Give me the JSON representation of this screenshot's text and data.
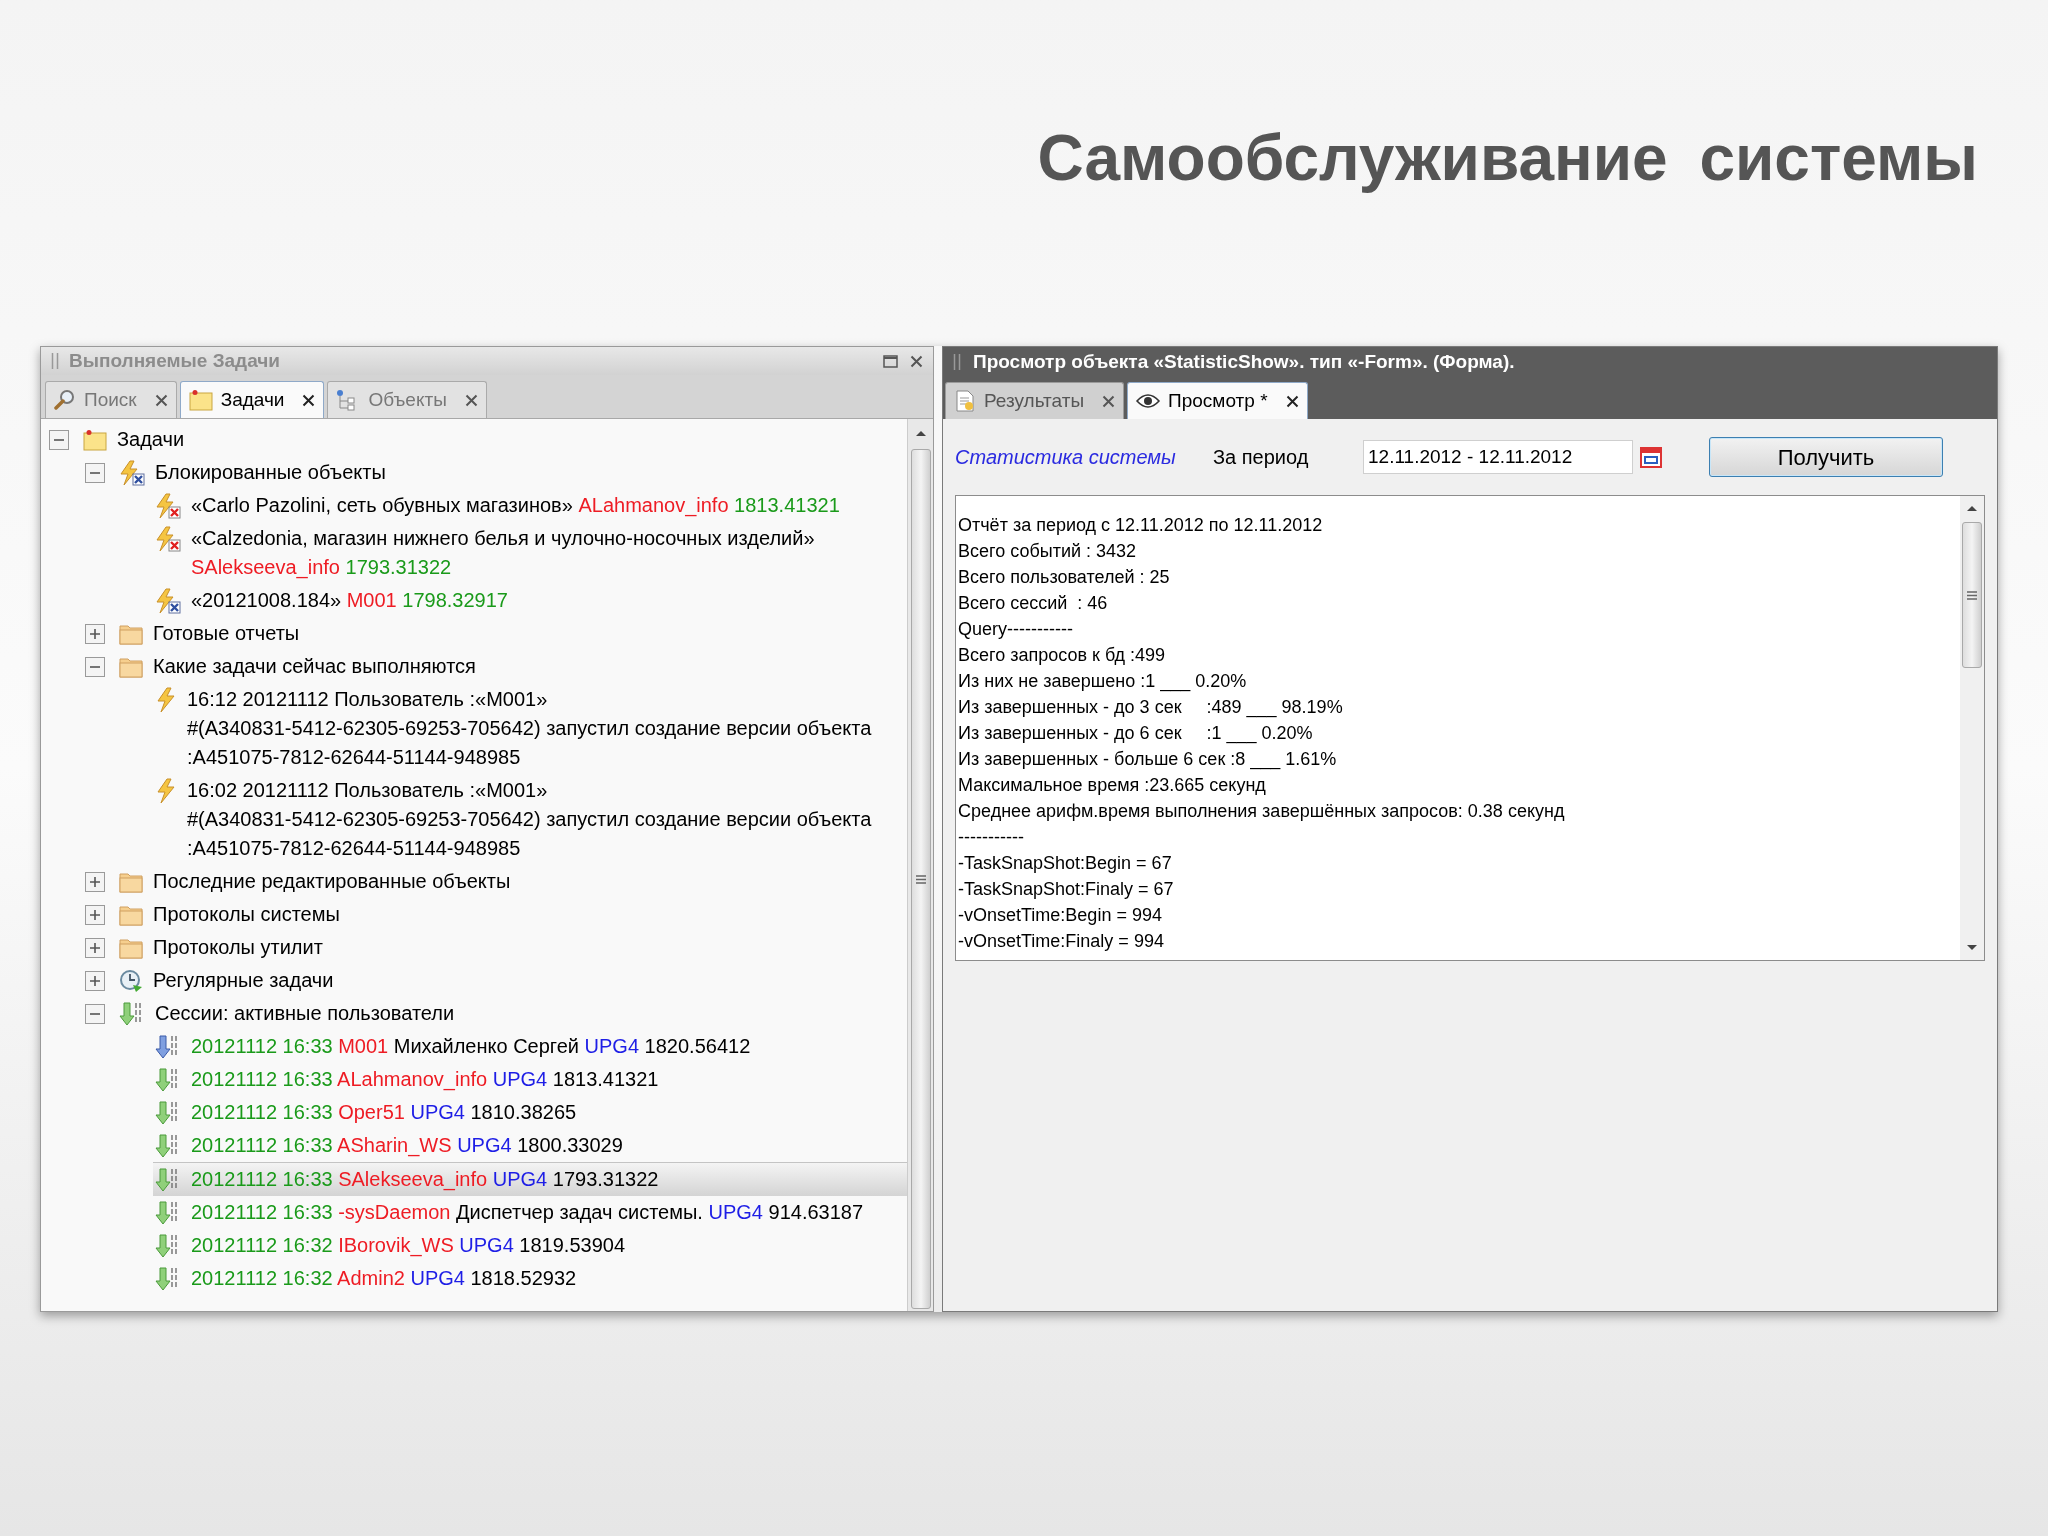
{
  "slide_title": "Самообслуживание системы",
  "left_panel": {
    "title": "Выполняемые Задачи",
    "tabs": [
      {
        "label": "Поиск",
        "kind": "search",
        "selected": false
      },
      {
        "label": "Задачи",
        "kind": "tasks",
        "selected": true
      },
      {
        "label": "Объекты",
        "kind": "hierarchy",
        "selected": false
      }
    ],
    "tree": {
      "kind": "tasks",
      "expanded": true,
      "selected": false,
      "label": [
        {
          "text": "Задачи",
          "color": "#000000"
        }
      ],
      "children": [
        {
          "kind": "locked",
          "expanded": true,
          "selected": false,
          "label": [
            {
              "text": "Блокированные объекты",
              "color": "#000000"
            }
          ],
          "children": [
            {
              "kind": "blocked",
              "selected": false,
              "label": [
                {
                  "text": "«Carlo Pazolini, сеть обувных магазинов»",
                  "color": "#000000"
                },
                {
                  "text": "ALahmanov_info",
                  "color": "#ee1c24"
                },
                {
                  "text": "1813.41321",
                  "color": "#1a9a1a"
                }
              ]
            },
            {
              "kind": "blocked",
              "selected": false,
              "label": [
                {
                  "text": "«Calzedonia, магазин нижнего белья и чулочно-носочных изделий»",
                  "color": "#000000"
                },
                {
                  "text": "SAlekseeva_info",
                  "color": "#ee1c24"
                },
                {
                  "text": "1793.31322",
                  "color": "#1a9a1a"
                }
              ]
            },
            {
              "kind": "locked",
              "selected": false,
              "label": [
                {
                  "text": "«20121008.184»",
                  "color": "#000000"
                },
                {
                  "text": "M001",
                  "color": "#ee1c24"
                },
                {
                  "text": "1798.32917",
                  "color": "#1a9a1a"
                }
              ]
            }
          ]
        },
        {
          "kind": "folder",
          "expanded": false,
          "selected": false,
          "label": [
            {
              "text": "Готовые отчеты",
              "color": "#000000"
            }
          ]
        },
        {
          "kind": "folder",
          "expanded": true,
          "selected": false,
          "label": [
            {
              "text": "Какие задачи сейчас выполняются",
              "color": "#000000"
            }
          ],
          "children": [
            {
              "kind": "bolt",
              "selected": false,
              "lines": [
                "16:12 20121112 Пользователь :«M001»",
                "#(A340831-5412-62305-69253-705642) запустил создание версии объекта",
                ":A451075-7812-62644-51144-948985"
              ]
            },
            {
              "kind": "bolt",
              "selected": false,
              "lines": [
                "16:02 20121112 Пользователь :«M001»",
                "#(A340831-5412-62305-69253-705642) запустил создание версии объекта",
                ":A451075-7812-62644-51144-948985"
              ]
            }
          ]
        },
        {
          "kind": "folder",
          "expanded": false,
          "selected": false,
          "label": [
            {
              "text": "Последние редактированные объекты",
              "color": "#000000"
            }
          ]
        },
        {
          "kind": "folder",
          "expanded": false,
          "selected": false,
          "label": [
            {
              "text": "Протоколы системы",
              "color": "#000000"
            }
          ]
        },
        {
          "kind": "folder",
          "expanded": false,
          "selected": false,
          "label": [
            {
              "text": "Протоколы утилит",
              "color": "#000000"
            }
          ]
        },
        {
          "kind": "schedule",
          "expanded": false,
          "selected": false,
          "label": [
            {
              "text": "Регулярные задачи",
              "color": "#000000"
            }
          ]
        },
        {
          "kind": "session",
          "expanded": true,
          "selected": false,
          "label": [
            {
              "text": "Сессии: активные пользователи",
              "color": "#000000"
            }
          ],
          "children": [
            {
              "kind": "current",
              "selected": false,
              "label": [
                {
                  "text": "20121112 16:33",
                  "color": "#1a9a1a"
                },
                {
                  "text": "M001",
                  "color": "#ee1c24"
                },
                {
                  "text": "Михайленко Сергей",
                  "color": "#000000"
                },
                {
                  "text": "UPG4",
                  "color": "#1e1ee6"
                },
                {
                  "text": "1820.56412",
                  "color": "#000000"
                }
              ]
            },
            {
              "kind": "session",
              "selected": false,
              "label": [
                {
                  "text": "20121112 16:33",
                  "color": "#1a9a1a"
                },
                {
                  "text": "ALahmanov_info",
                  "color": "#ee1c24"
                },
                {
                  "text": "UPG4",
                  "color": "#1e1ee6"
                },
                {
                  "text": "1813.41321",
                  "color": "#000000"
                }
              ]
            },
            {
              "kind": "session",
              "selected": false,
              "label": [
                {
                  "text": "20121112 16:33",
                  "color": "#1a9a1a"
                },
                {
                  "text": "Oper51",
                  "color": "#ee1c24"
                },
                {
                  "text": "UPG4",
                  "color": "#1e1ee6"
                },
                {
                  "text": "1810.38265",
                  "color": "#000000"
                }
              ]
            },
            {
              "kind": "session",
              "selected": false,
              "label": [
                {
                  "text": "20121112 16:33",
                  "color": "#1a9a1a"
                },
                {
                  "text": "ASharin_WS",
                  "color": "#ee1c24"
                },
                {
                  "text": "UPG4",
                  "color": "#1e1ee6"
                },
                {
                  "text": "1800.33029",
                  "color": "#000000"
                }
              ]
            },
            {
              "kind": "session",
              "selected": true,
              "label": [
                {
                  "text": "20121112 16:33",
                  "color": "#1a9a1a"
                },
                {
                  "text": "SAlekseeva_info",
                  "color": "#ee1c24"
                },
                {
                  "text": "UPG4",
                  "color": "#1e1ee6"
                },
                {
                  "text": "1793.31322",
                  "color": "#000000"
                }
              ]
            },
            {
              "kind": "session",
              "selected": false,
              "label": [
                {
                  "text": "20121112 16:33",
                  "color": "#1a9a1a"
                },
                {
                  "text": "-sysDaemon",
                  "color": "#ee1c24"
                },
                {
                  "text": "Диспетчер задач системы.",
                  "color": "#000000"
                },
                {
                  "text": "UPG4",
                  "color": "#1e1ee6"
                },
                {
                  "text": "914.63187",
                  "color": "#000000"
                }
              ]
            },
            {
              "kind": "session",
              "selected": false,
              "label": [
                {
                  "text": "20121112 16:32",
                  "color": "#1a9a1a"
                },
                {
                  "text": "IBorovik_WS",
                  "color": "#ee1c24"
                },
                {
                  "text": "UPG4",
                  "color": "#1e1ee6"
                },
                {
                  "text": "1819.53904",
                  "color": "#000000"
                }
              ]
            },
            {
              "kind": "session",
              "selected": false,
              "label": [
                {
                  "text": "20121112 16:32",
                  "color": "#1a9a1a"
                },
                {
                  "text": "Admin2",
                  "color": "#ee1c24"
                },
                {
                  "text": "UPG4",
                  "color": "#1e1ee6"
                },
                {
                  "text": "1818.52932",
                  "color": "#000000"
                }
              ]
            }
          ]
        }
      ]
    }
  },
  "right_panel": {
    "title": "Просмотр объекта «StatisticShow». тип «-Form». (Форма).",
    "tabs": [
      {
        "label": "Результаты",
        "kind": "report",
        "selected": false
      },
      {
        "label": "Просмотр *",
        "kind": "view",
        "selected": true
      }
    ],
    "form": {
      "heading": "Статистика системы",
      "period_label": "За период",
      "period_value": "12.11.2012 - 12.11.2012",
      "button": "Получить"
    },
    "report_lines": [
      "Отчёт за период с 12.11.2012 по 12.11.2012",
      "Всего событий : 3432",
      "Всего пользователей : 25",
      "Всего сессий  : 46",
      "Query-----------",
      "Всего запросов к бд :499",
      "Из них не завершено :1 ___ 0.20%",
      "Из завершенных - до 3 сек     :489 ___ 98.19%",
      "Из завершенных - до 6 сек     :1 ___ 0.20%",
      "Из завершенных - больше 6 сек :8 ___ 1.61%",
      "Максимальное время :23.665 секунд",
      "Среднее арифм.время выполнения завершённых запросов: 0.38 секунд",
      "-----------",
      "-TaskSnapShot:Begin = 67",
      "-TaskSnapShot:Finaly = 67",
      "-vOnsetTime:Begin = 994",
      "-vOnsetTime:Finaly = 994"
    ]
  }
}
